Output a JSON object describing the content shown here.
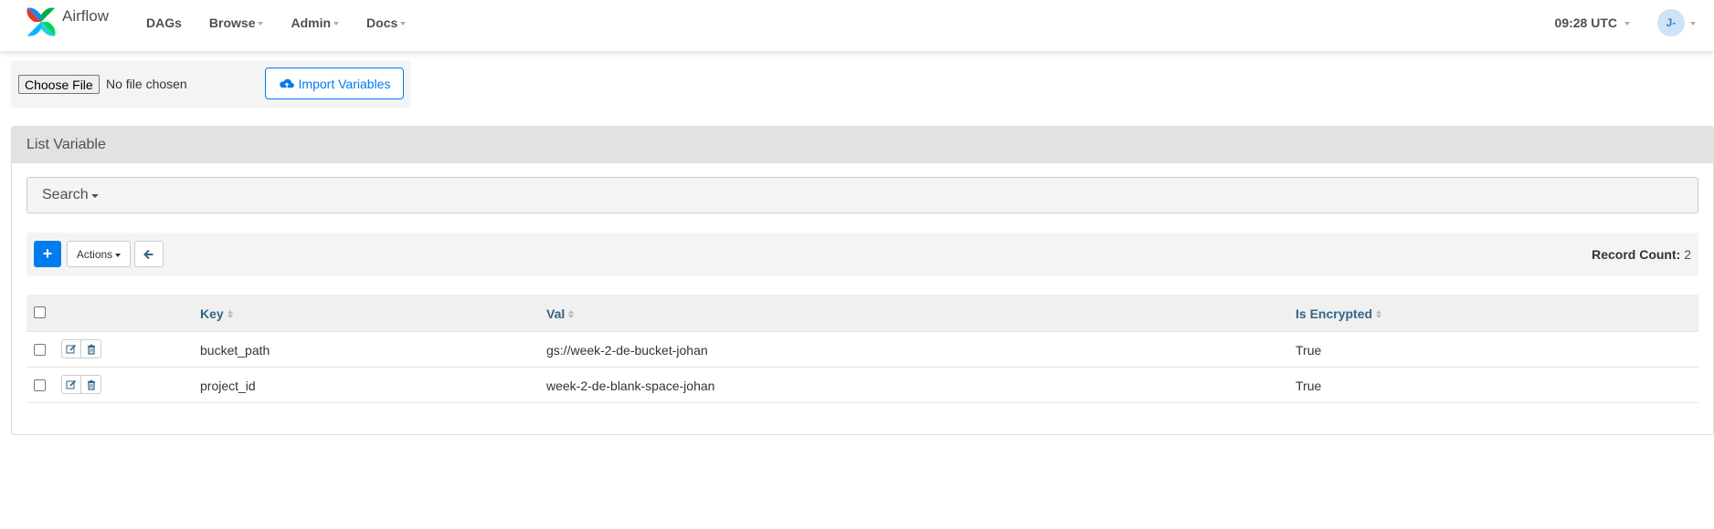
{
  "navbar": {
    "brand": "Airflow",
    "menu": [
      {
        "label": "DAGs",
        "dropdown": false
      },
      {
        "label": "Browse",
        "dropdown": true
      },
      {
        "label": "Admin",
        "dropdown": true
      },
      {
        "label": "Docs",
        "dropdown": true
      }
    ],
    "clock": "09:28 UTC",
    "user_initials": "J-"
  },
  "import_form": {
    "choose_file_label": "Choose File",
    "no_file_text": "No file chosen",
    "import_button_label": "Import Variables"
  },
  "list": {
    "heading": "List Variable",
    "search_label": "Search",
    "actions_label": "Actions",
    "record_count_label": "Record Count:",
    "record_count_value": "2",
    "columns": [
      "Key",
      "Val",
      "Is Encrypted"
    ],
    "rows": [
      {
        "key": "bucket_path",
        "val": "gs://week-2-de-bucket-johan",
        "is_encrypted": "True"
      },
      {
        "key": "project_id",
        "val": "week-2-de-blank-space-johan",
        "is_encrypted": "True"
      }
    ]
  },
  "colors": {
    "primary": "#017cee",
    "header_link": "#336688",
    "panel_heading_bg": "#e2e2e2"
  }
}
